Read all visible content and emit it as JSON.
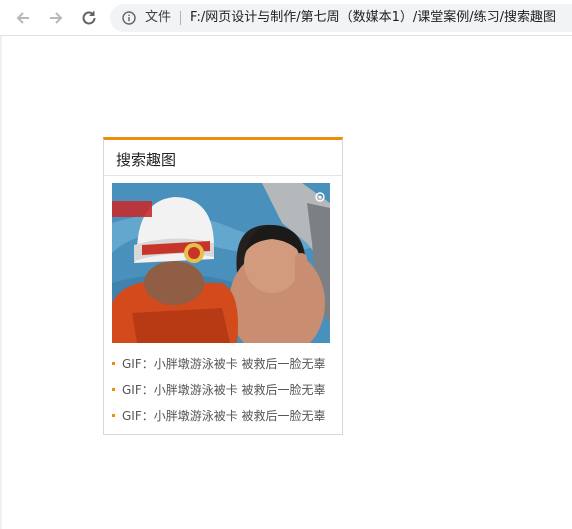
{
  "browser": {
    "address_label": "文件",
    "url": "F:/网页设计与制作/第七周（数媒本1）/课堂案例/练习/搜索趣图"
  },
  "widget": {
    "title": "搜索趣图",
    "items": [
      "GIF：小胖墩游泳被卡 被救后一脸无辜",
      "GIF：小胖墩游泳被卡 被救后一脸无辜",
      "GIF：小胖墩游泳被卡 被救后一脸无辜"
    ],
    "accent_color": "#ec8d0b"
  }
}
